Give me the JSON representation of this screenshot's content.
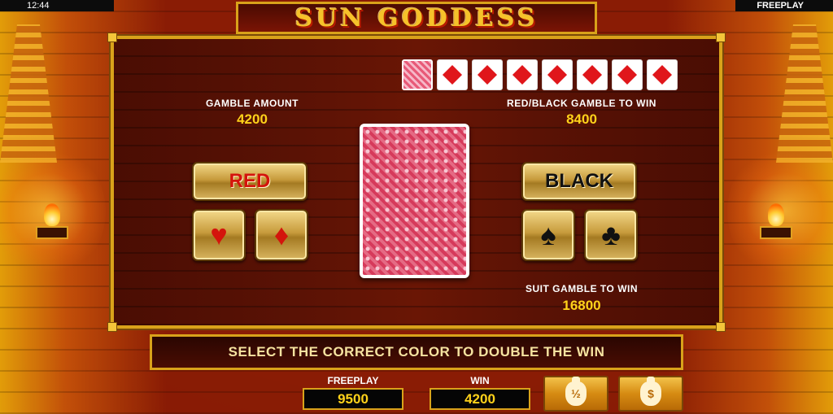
{
  "status": {
    "time": "12:44",
    "mode": "FREEPLAY"
  },
  "title": "SUN GODDESS",
  "history": {
    "cards": [
      {
        "type": "back"
      },
      {
        "type": "diamond"
      },
      {
        "type": "diamond"
      },
      {
        "type": "diamond"
      },
      {
        "type": "diamond"
      },
      {
        "type": "diamond"
      },
      {
        "type": "diamond"
      },
      {
        "type": "diamond"
      }
    ]
  },
  "gamble": {
    "amount_label": "GAMBLE AMOUNT",
    "amount_value": "4200",
    "color_win_label": "RED/BLACK GAMBLE TO WIN",
    "color_win_value": "8400",
    "suit_win_label": "SUIT GAMBLE TO WIN",
    "suit_win_value": "16800"
  },
  "buttons": {
    "red": "RED",
    "black": "BLACK",
    "hearts": "♥",
    "diamonds": "♦",
    "spades": "♠",
    "clubs": "♣"
  },
  "message": "SELECT THE CORRECT COLOR TO DOUBLE THE WIN",
  "meters": {
    "freeplay_label": "FREEPLAY",
    "freeplay_value": "9500",
    "win_label": "WIN",
    "win_value": "4200"
  },
  "actions": {
    "half_collect": "½",
    "collect": "$"
  },
  "colors": {
    "gold": "#d9a21a",
    "red": "#d4140c",
    "value_yellow": "#ffd21a"
  }
}
